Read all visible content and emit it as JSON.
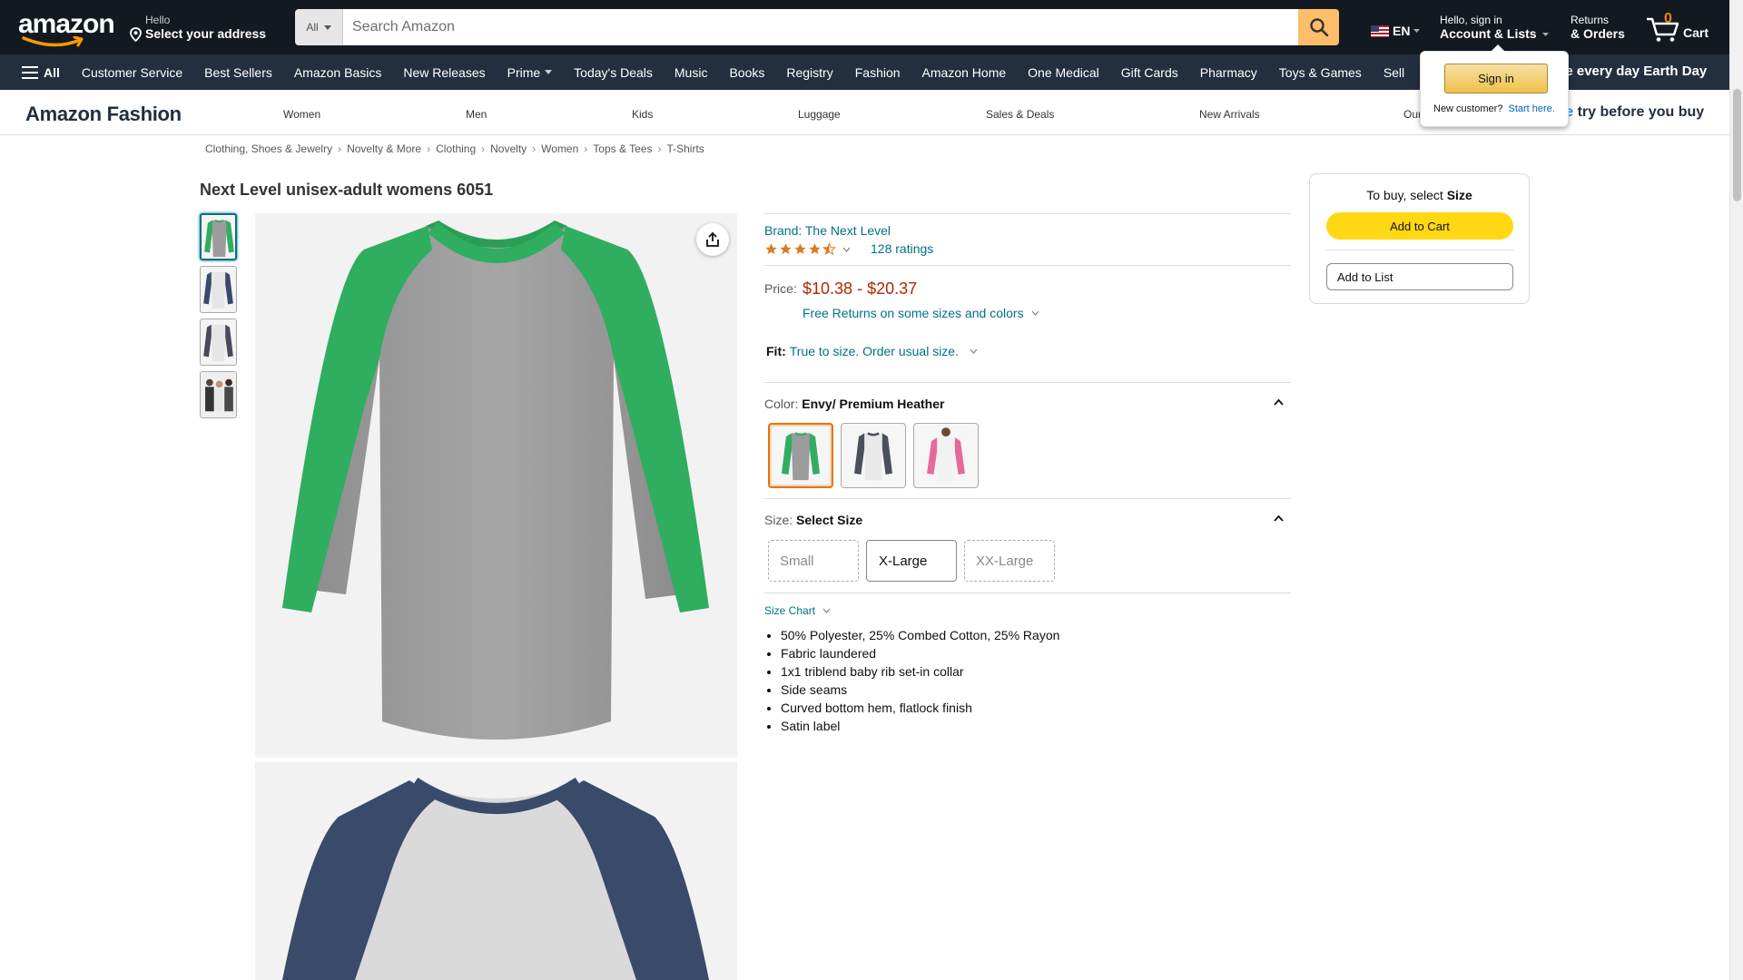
{
  "header": {
    "logo_text": "amazon",
    "deliver_small": "Hello",
    "deliver_big": "Select your address",
    "search_category": "All",
    "search_placeholder": "Search Amazon",
    "language": "EN",
    "account_small": "Hello, sign in",
    "account_big": "Account & Lists",
    "orders_small": "Returns",
    "orders_big": "& Orders",
    "cart_count": "0",
    "cart_label": "Cart"
  },
  "subnav": {
    "all_label": "All",
    "items": [
      "Customer Service",
      "Best Sellers",
      "Amazon Basics",
      "New Releases",
      "Prime",
      "Today's Deals",
      "Music",
      "Books",
      "Registry",
      "Fashion",
      "Amazon Home",
      "One Medical",
      "Gift Cards",
      "Pharmacy",
      "Toys & Games",
      "Sell"
    ],
    "promo": "ke every day Earth Day"
  },
  "signin_flyout": {
    "button": "Sign in",
    "new_customer": "New customer?",
    "start_here": "Start here."
  },
  "fashion_bar": {
    "title": "Amazon Fashion",
    "links": [
      "Women",
      "Men",
      "Kids",
      "Luggage",
      "Sales & Deals",
      "New Arrivals",
      "Our"
    ],
    "promo_prime": "me",
    "promo_rest": " try before you buy"
  },
  "breadcrumb": [
    "Clothing, Shoes & Jewelry",
    "Novelty & More",
    "Clothing",
    "Novelty",
    "Women",
    "Tops & Tees",
    "T-Shirts"
  ],
  "product": {
    "title": "Next Level unisex-adult womens 6051",
    "brand": "Brand: The Next Level",
    "rating": 4.5,
    "ratings_count": "128 ratings",
    "price_label": "Price:",
    "price_low": "$10.38",
    "price_sep": "-",
    "price_high": "$20.37",
    "free_returns": "Free Returns on some sizes and colors",
    "fit_label": "Fit:",
    "fit_value": "True to size. Order usual size.",
    "color_label": "Color:",
    "color_value": "Envy/ Premium Heather",
    "size_label": "Size:",
    "size_value": "Select Size",
    "sizes": [
      "Small",
      "X-Large",
      "XX-Large"
    ],
    "size_chart": "Size Chart",
    "bullets": [
      "50% Polyester, 25% Combed Cotton, 25% Rayon",
      "Fabric laundered",
      "1x1 triblend baby rib set-in collar",
      "Side seams",
      "Curved bottom hem, flatlock finish",
      "Satin label"
    ]
  },
  "buybox": {
    "to_buy_prefix": "To buy, select",
    "to_buy_bold": "Size",
    "add_to_cart": "Add to Cart",
    "add_to_list": "Add to List"
  },
  "colors": {
    "nav_dark": "#131921",
    "subnav": "#232f3e",
    "link": "#007185",
    "price": "#b12704",
    "cart_button": "#ffd814",
    "search_button": "#febd69",
    "envy_green": "#2fae5f",
    "heather_gray": "#9a9a9a",
    "navy": "#3a4a6b",
    "pink": "#e8689b"
  }
}
